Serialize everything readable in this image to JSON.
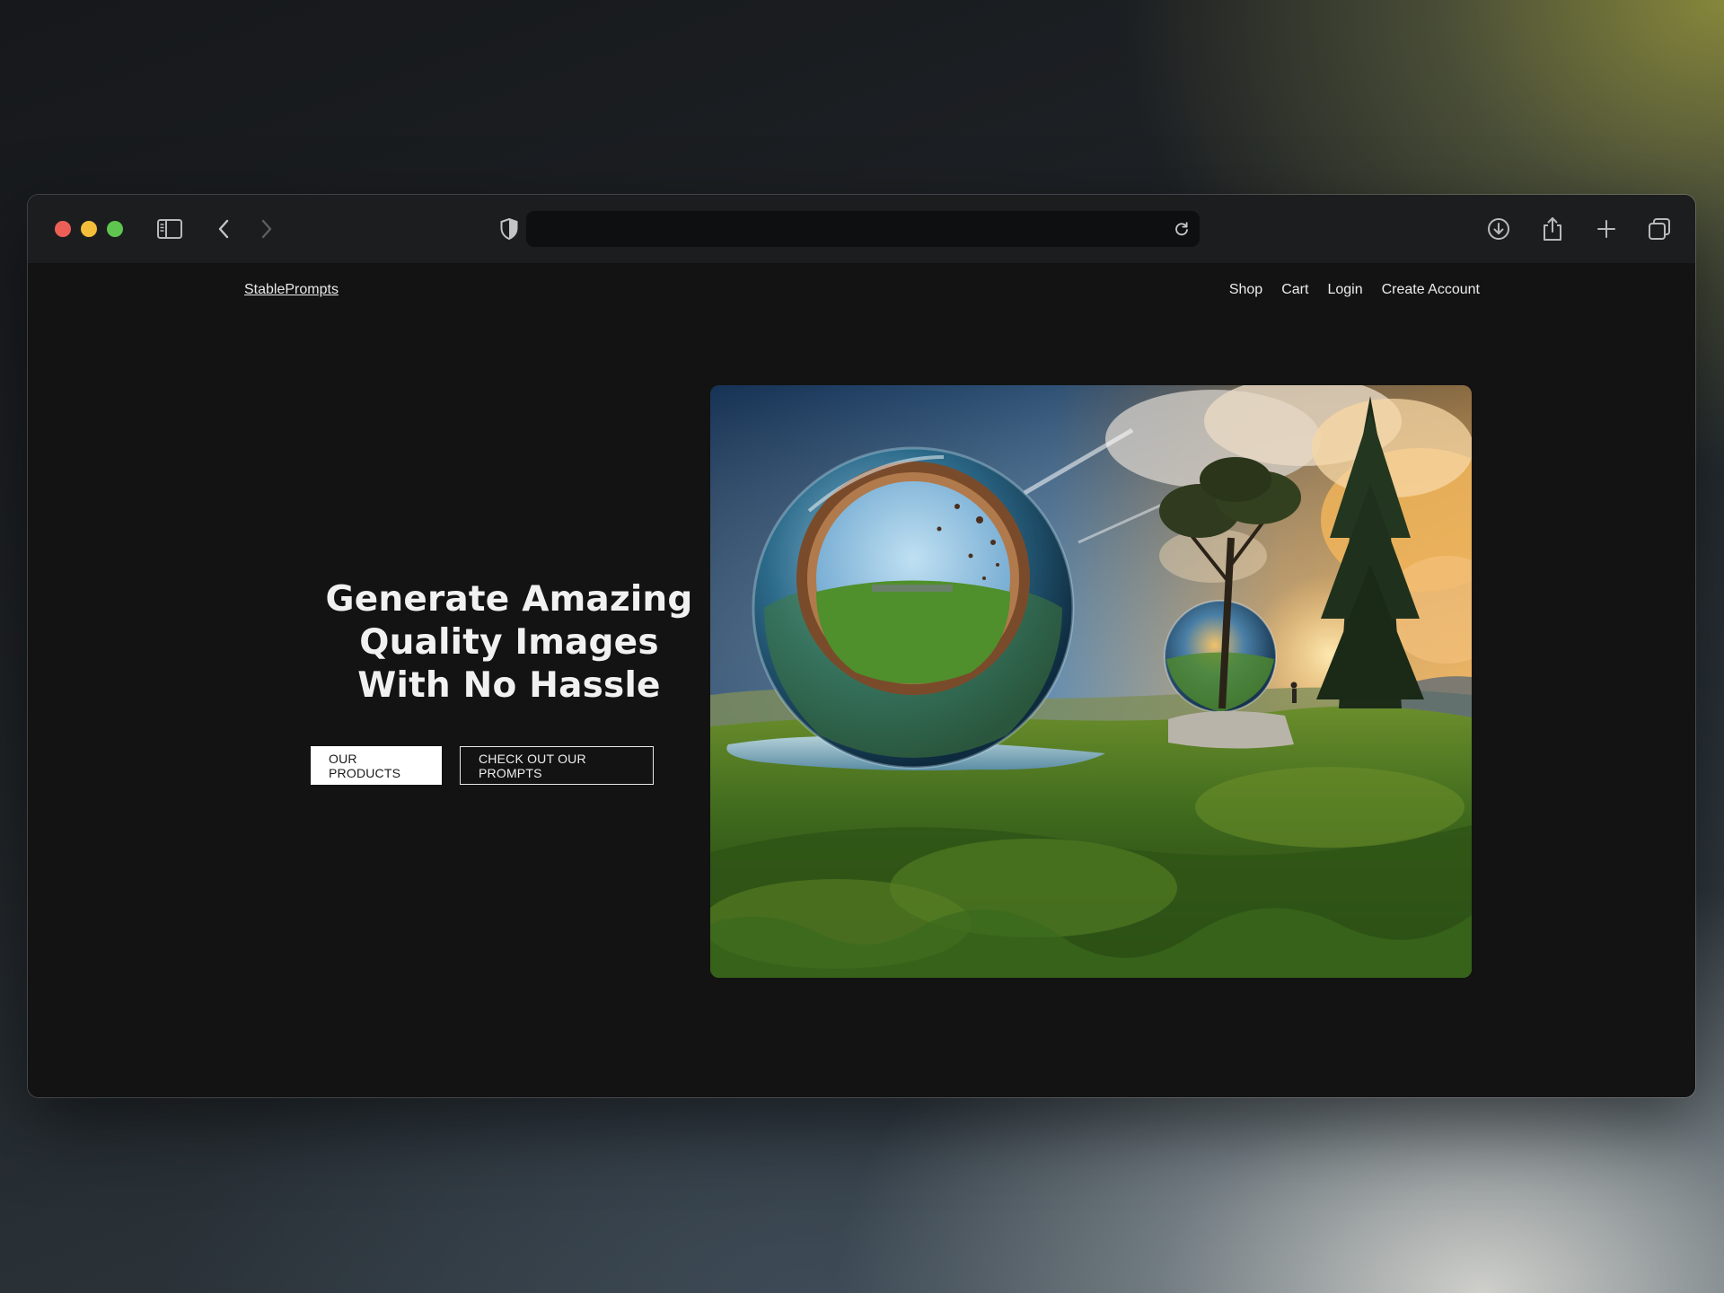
{
  "browser": {
    "traffic_lights": {
      "close_color": "#ec5f57",
      "minimize_color": "#f4be3b",
      "maximize_color": "#5fc550"
    },
    "icons": [
      "sidebar-icon",
      "back-icon",
      "forward-icon",
      "shield-icon",
      "reload-icon",
      "download-icon",
      "share-icon",
      "new-tab-icon",
      "tabs-overview-icon"
    ],
    "url": ""
  },
  "site": {
    "brand": "StablePrompts",
    "nav": [
      "Shop",
      "Cart",
      "Login",
      "Create Account"
    ]
  },
  "hero": {
    "headline_lines": [
      "Generate Amazing",
      "Quality Images",
      "With No Hassle"
    ],
    "primary_button": "OUR PRODUCTS",
    "secondary_button": "CHECK OUT OUR PROMPTS",
    "image_alt": "surreal landscape with glass spheres on green hills at sunset"
  }
}
